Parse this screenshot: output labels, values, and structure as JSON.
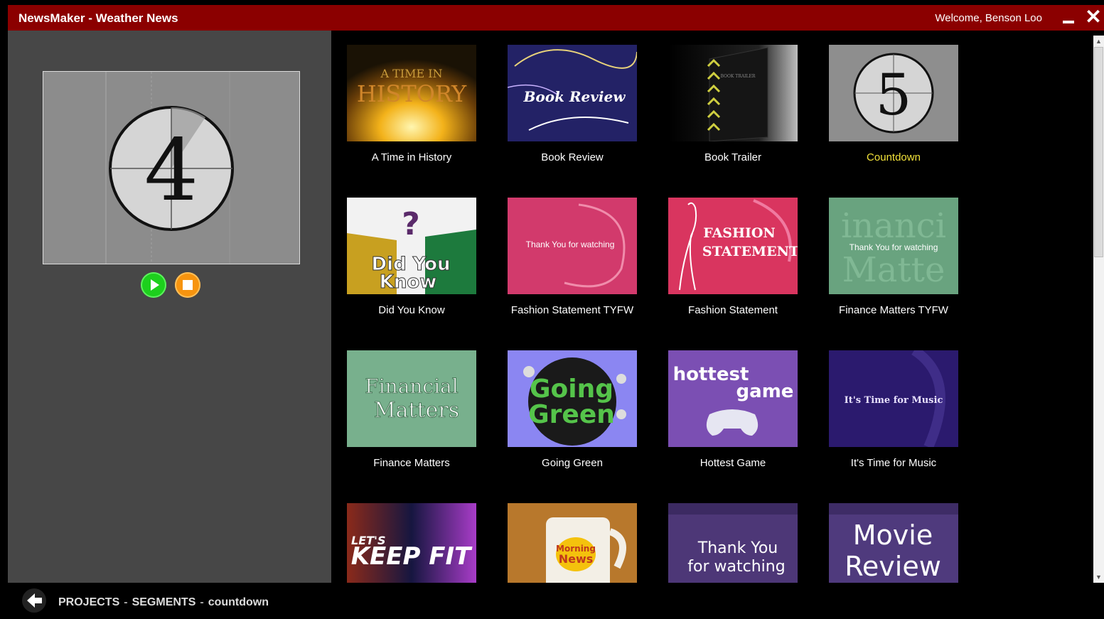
{
  "window": {
    "title": "NewsMaker - Weather News",
    "welcome": "Welcome,  Benson Loo"
  },
  "preview": {
    "number": "4"
  },
  "tiles": [
    {
      "caption": "A Time in History",
      "thumb_text": [
        "A TIME IN",
        "HISTORY"
      ]
    },
    {
      "caption": "Book Review",
      "thumb_text": [
        "Book Review"
      ]
    },
    {
      "caption": "Book Trailer",
      "thumb_text": [
        "BOOK TRAILER"
      ]
    },
    {
      "caption": "Countdown",
      "thumb_text": [
        "5"
      ],
      "selected": true
    },
    {
      "caption": "Did You Know",
      "thumb_text": [
        "Did You",
        "Know"
      ]
    },
    {
      "caption": "Fashion Statement TYFW",
      "thumb_text": [
        "Thank You for watching"
      ]
    },
    {
      "caption": "Fashion Statement",
      "thumb_text": [
        "FASHION",
        "STATEMENT"
      ]
    },
    {
      "caption": "Finance Matters TYFW",
      "thumb_text": [
        "Thank You for watching"
      ]
    },
    {
      "caption": "Finance Matters",
      "thumb_text": [
        "Financial",
        "Matters"
      ]
    },
    {
      "caption": "Going Green",
      "thumb_text": [
        "Going",
        "Green"
      ]
    },
    {
      "caption": "Hottest Game",
      "thumb_text": [
        "hottest",
        "game"
      ]
    },
    {
      "caption": "It's Time for Music",
      "thumb_text": [
        "It's Time for Music"
      ]
    },
    {
      "caption": "",
      "thumb_text": [
        "LET'S",
        "KEEP FIT"
      ]
    },
    {
      "caption": "",
      "thumb_text": [
        "Morning",
        "News"
      ]
    },
    {
      "caption": "",
      "thumb_text": [
        "Thank You",
        "for watching"
      ]
    },
    {
      "caption": "",
      "thumb_text": [
        "Movie",
        "Review"
      ]
    }
  ],
  "breadcrumb": {
    "projects": "PROJECTS",
    "segments": "SEGMENTS",
    "current": "countdown",
    "separator": "-"
  },
  "colors": {
    "titlebar": "#8b0000",
    "selected_caption": "#f2e23a",
    "panel": "#474747"
  }
}
